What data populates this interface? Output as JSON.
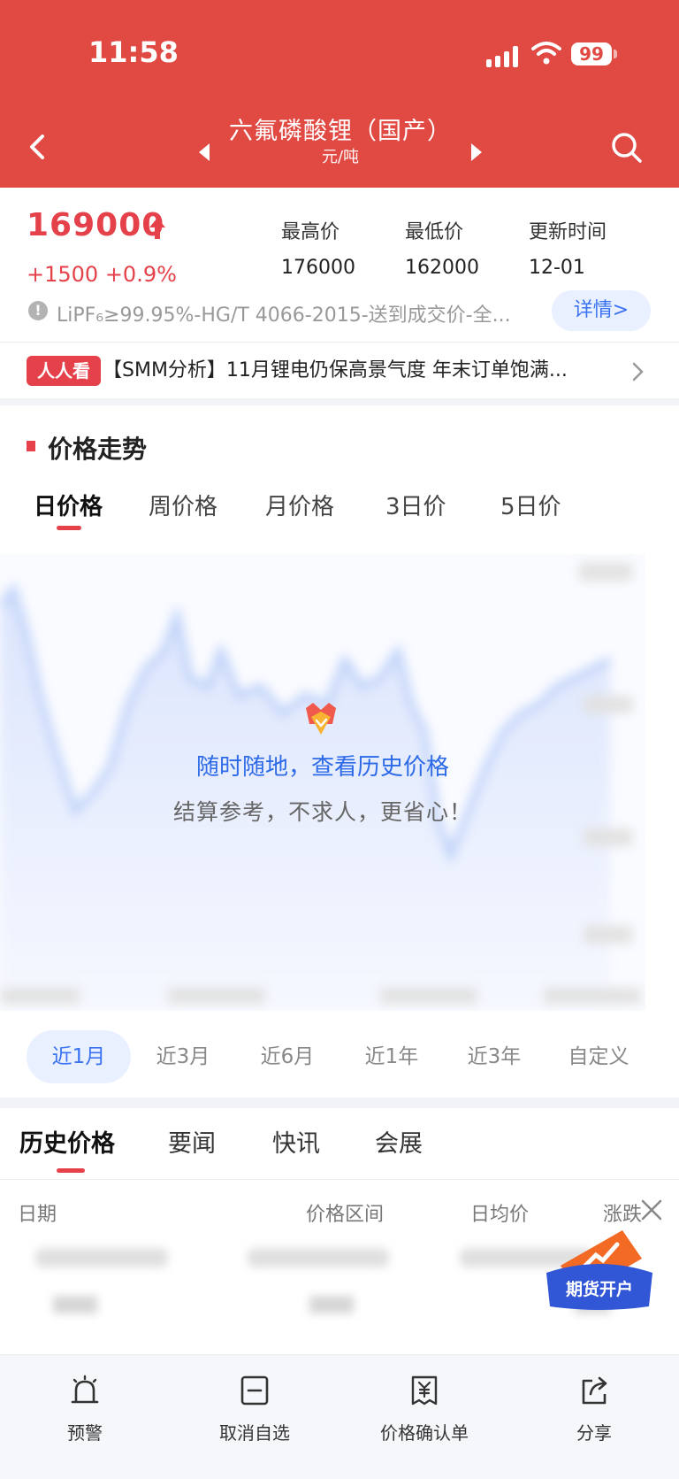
{
  "status_bar": {
    "time": "11:58",
    "battery": "99"
  },
  "header": {
    "title": "六氟磷酸锂（国产）",
    "unit": "元/吨"
  },
  "price": {
    "current": "169000",
    "change": "+1500 +0.9%",
    "high_label": "最高价",
    "high_value": "176000",
    "low_label": "最低价",
    "low_value": "162000",
    "update_label": "更新时间",
    "update_value": "12-01",
    "spec": "LiPF₆≥99.95%-HG/T 4066-2015-送到成交价-全...",
    "detail_button": "详情>"
  },
  "news": {
    "badge": "人人看",
    "text": "【SMM分析】11月锂电仍保高景气度 年末订单饱满..."
  },
  "trend": {
    "section_title": "价格走势",
    "tabs": [
      "日价格",
      "周价格",
      "月价格",
      "3日价",
      "5日价"
    ],
    "active_tab": 0,
    "promo_title": "随时随地，查看历史价格",
    "promo_subtitle": "结算参考，不求人，更省心！",
    "ranges": [
      "近1月",
      "近3月",
      "近6月",
      "近1年",
      "近3年",
      "自定义"
    ],
    "active_range": 0,
    "accent": "#3a72f1"
  },
  "lower_tabs": {
    "tabs": [
      "历史价格",
      "要闻",
      "快讯",
      "会展"
    ],
    "active_tab": 0,
    "columns": [
      "日期",
      "价格区间",
      "日均价",
      "涨跌"
    ]
  },
  "futures_badge": "期货开户",
  "bottom_bar": {
    "items": [
      {
        "label": "预警",
        "icon": "alarm-icon"
      },
      {
        "label": "取消自选",
        "icon": "minus-square-icon"
      },
      {
        "label": "价格确认单",
        "icon": "yuan-document-icon"
      },
      {
        "label": "分享",
        "icon": "share-icon"
      }
    ]
  },
  "colors": {
    "header_red": "#e14943",
    "price_red": "#e5414a",
    "link_blue": "#3a72f1"
  }
}
